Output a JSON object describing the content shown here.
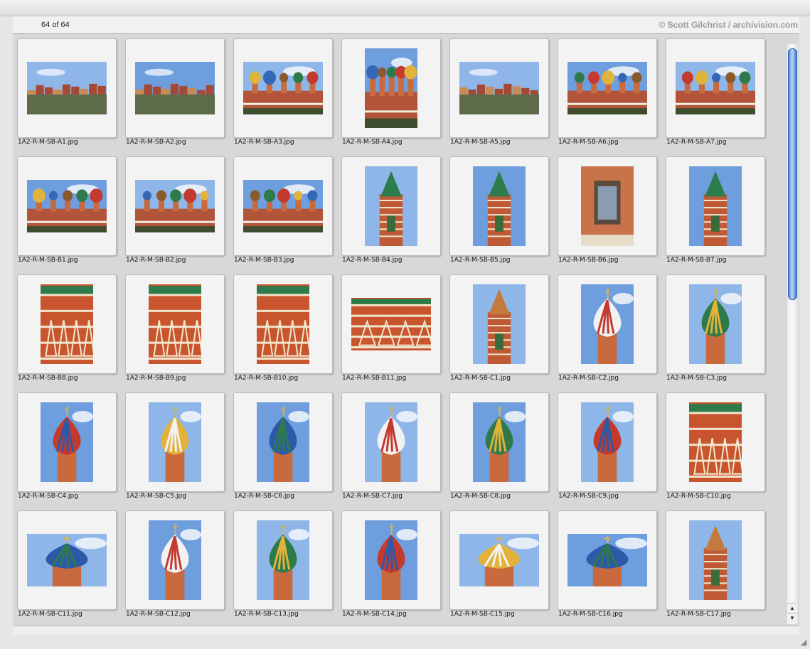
{
  "header": {
    "count_label": "64 of 64",
    "credit": "© Scott Gilchrist / archivision.com"
  },
  "colors": {
    "accent": "#3d78cc",
    "panel": "#d8d8d8",
    "slide": "#f3f3f3"
  },
  "scrollbar": {
    "up_arrow": "▲",
    "down_arrow": "▼",
    "position_fraction": 0.0
  },
  "resize_grip_icon": "◢",
  "thumbnails": [
    {
      "name": "1A2-R-M-SB-A1.jpg",
      "o": "land",
      "scene": "panorama"
    },
    {
      "name": "1A2-R-M-SB-A2.jpg",
      "o": "land",
      "scene": "panorama"
    },
    {
      "name": "1A2-R-M-SB-A3.jpg",
      "o": "land",
      "scene": "towers"
    },
    {
      "name": "1A2-R-M-SB-A4.jpg",
      "o": "port",
      "scene": "towers"
    },
    {
      "name": "1A2-R-M-SB-A5.jpg",
      "o": "land",
      "scene": "panorama"
    },
    {
      "name": "1A2-R-M-SB-A6.jpg",
      "o": "land",
      "scene": "domes"
    },
    {
      "name": "1A2-R-M-SB-A7.jpg",
      "o": "land",
      "scene": "domes"
    },
    {
      "name": "1A2-R-M-SB-B1.jpg",
      "o": "land",
      "scene": "facade"
    },
    {
      "name": "1A2-R-M-SB-B2.jpg",
      "o": "land",
      "scene": "facade"
    },
    {
      "name": "1A2-R-M-SB-B3.jpg",
      "o": "land",
      "scene": "facade"
    },
    {
      "name": "1A2-R-M-SB-B4.jpg",
      "o": "port",
      "scene": "tower"
    },
    {
      "name": "1A2-R-M-SB-B5.jpg",
      "o": "port",
      "scene": "tower"
    },
    {
      "name": "1A2-R-M-SB-B6.jpg",
      "o": "port",
      "scene": "window"
    },
    {
      "name": "1A2-R-M-SB-B7.jpg",
      "o": "port",
      "scene": "tower"
    },
    {
      "name": "1A2-R-M-SB-B8.jpg",
      "o": "port",
      "scene": "brick"
    },
    {
      "name": "1A2-R-M-SB-B9.jpg",
      "o": "port",
      "scene": "brick"
    },
    {
      "name": "1A2-R-M-SB-B10.jpg",
      "o": "port",
      "scene": "brick"
    },
    {
      "name": "1A2-R-M-SB-B11.jpg",
      "o": "land",
      "scene": "brick"
    },
    {
      "name": "1A2-R-M-SB-C1.jpg",
      "o": "port",
      "scene": "spire"
    },
    {
      "name": "1A2-R-M-SB-C2.jpg",
      "o": "port",
      "scene": "onion"
    },
    {
      "name": "1A2-R-M-SB-C3.jpg",
      "o": "port",
      "scene": "onion"
    },
    {
      "name": "1A2-R-M-SB-C4.jpg",
      "o": "port",
      "scene": "onion"
    },
    {
      "name": "1A2-R-M-SB-C5.jpg",
      "o": "port",
      "scene": "onion"
    },
    {
      "name": "1A2-R-M-SB-C6.jpg",
      "o": "port",
      "scene": "onion"
    },
    {
      "name": "1A2-R-M-SB-C7.jpg",
      "o": "port",
      "scene": "onion"
    },
    {
      "name": "1A2-R-M-SB-C8.jpg",
      "o": "port",
      "scene": "onion"
    },
    {
      "name": "1A2-R-M-SB-C9.jpg",
      "o": "port",
      "scene": "onion"
    },
    {
      "name": "1A2-R-M-SB-C10.jpg",
      "o": "port",
      "scene": "brick"
    },
    {
      "name": "1A2-R-M-SB-C11.jpg",
      "o": "land",
      "scene": "onion"
    },
    {
      "name": "1A2-R-M-SB-C12.jpg",
      "o": "port",
      "scene": "onion"
    },
    {
      "name": "1A2-R-M-SB-C13.jpg",
      "o": "port",
      "scene": "onion"
    },
    {
      "name": "1A2-R-M-SB-C14.jpg",
      "o": "port",
      "scene": "onion"
    },
    {
      "name": "1A2-R-M-SB-C15.jpg",
      "o": "land",
      "scene": "onion"
    },
    {
      "name": "1A2-R-M-SB-C16.jpg",
      "o": "land",
      "scene": "onion"
    },
    {
      "name": "1A2-R-M-SB-C17.jpg",
      "o": "port",
      "scene": "spire"
    }
  ]
}
